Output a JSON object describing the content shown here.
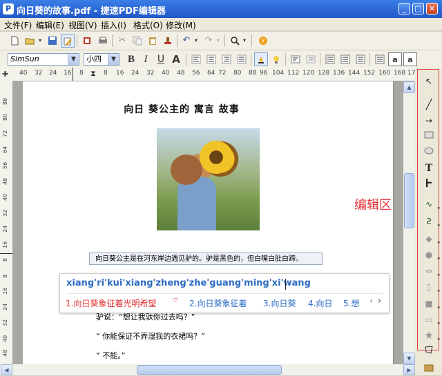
{
  "window": {
    "app_icon": "P",
    "title": "向日葵的故事.pdf - 捷速PDF编辑器",
    "buttons": {
      "minimize": "_",
      "maximize": "□",
      "close": "✕"
    }
  },
  "menu": [
    "文件(F)",
    "编辑(E)",
    "视图(V)",
    "插入(I)",
    "格式(O)",
    "修改(M)"
  ],
  "toolbar_main": {
    "icons": [
      "new-document-icon",
      "open-folder-icon",
      "save-icon",
      "edit-pen-icon",
      "export-icon",
      "print-icon",
      "cut-icon",
      "copy-icon",
      "paste-icon",
      "stamp-icon",
      "undo-icon",
      "redo-icon",
      "zoom-icon",
      "coins-icon"
    ]
  },
  "toolbar_format": {
    "font_name": "SimSun",
    "font_size": "小四",
    "bold": "B",
    "italic": "I",
    "underline": "U",
    "font_color": "A",
    "superscript": "a",
    "subscript": "a"
  },
  "ruler_h_ticks": [
    "40",
    "32",
    "24",
    "16",
    "8",
    "8",
    "16",
    "24",
    "32",
    "40",
    "48",
    "56",
    "64",
    "72",
    "80",
    "88",
    "96",
    "104",
    "112",
    "120",
    "128",
    "136",
    "144",
    "152",
    "160",
    "168",
    "17"
  ],
  "ruler_v_ticks": [
    "88",
    "80",
    "72",
    "64",
    "56",
    "48",
    "40",
    "32",
    "24",
    "16",
    "8",
    "8",
    "16",
    "24",
    "32",
    "40",
    "48",
    "56"
  ],
  "document": {
    "title": "向日 葵公主的 寓言 故事",
    "highlighted_line": "向日葵公主是在河东岸边遇见驴的。驴是黑色的，但白嘴白肚白蹄。",
    "lines": [
      "驴说：“想让我驮你过去吗？”",
      "“ 你能保证不弄湿我的衣裙吗？”",
      "“ 不能。”"
    ]
  },
  "annotation_label": "编辑区",
  "ime": {
    "pinyin": "xiang'ri'kui'xiang'zheng'zhe'guang'ming'xi'wang",
    "candidates": [
      "1.向日葵象征着光明希望",
      "2.向日葵象征着",
      "3.向日葵",
      "4.向日",
      "5.想"
    ],
    "prev": "‹",
    "next": "›"
  },
  "side_tools": [
    "select-arrow-icon",
    "line-icon",
    "arrow-line-icon",
    "rectangle-icon",
    "ellipse-icon",
    "text-tool-icon",
    "vertical-text-icon",
    "curve-icon",
    "polyline-icon",
    "diamond-icon",
    "circle-shape-icon",
    "double-arrow-icon",
    "cylinder-icon",
    "square-shape-icon",
    "speech-bubble-icon",
    "star-icon",
    "polygon-icon",
    "image-icon"
  ],
  "colors": {
    "titlebar": "#2257c8",
    "ime_selected": "#e03030",
    "ime_pinyin": "#2d6bc4",
    "annotation": "#e0343a"
  }
}
